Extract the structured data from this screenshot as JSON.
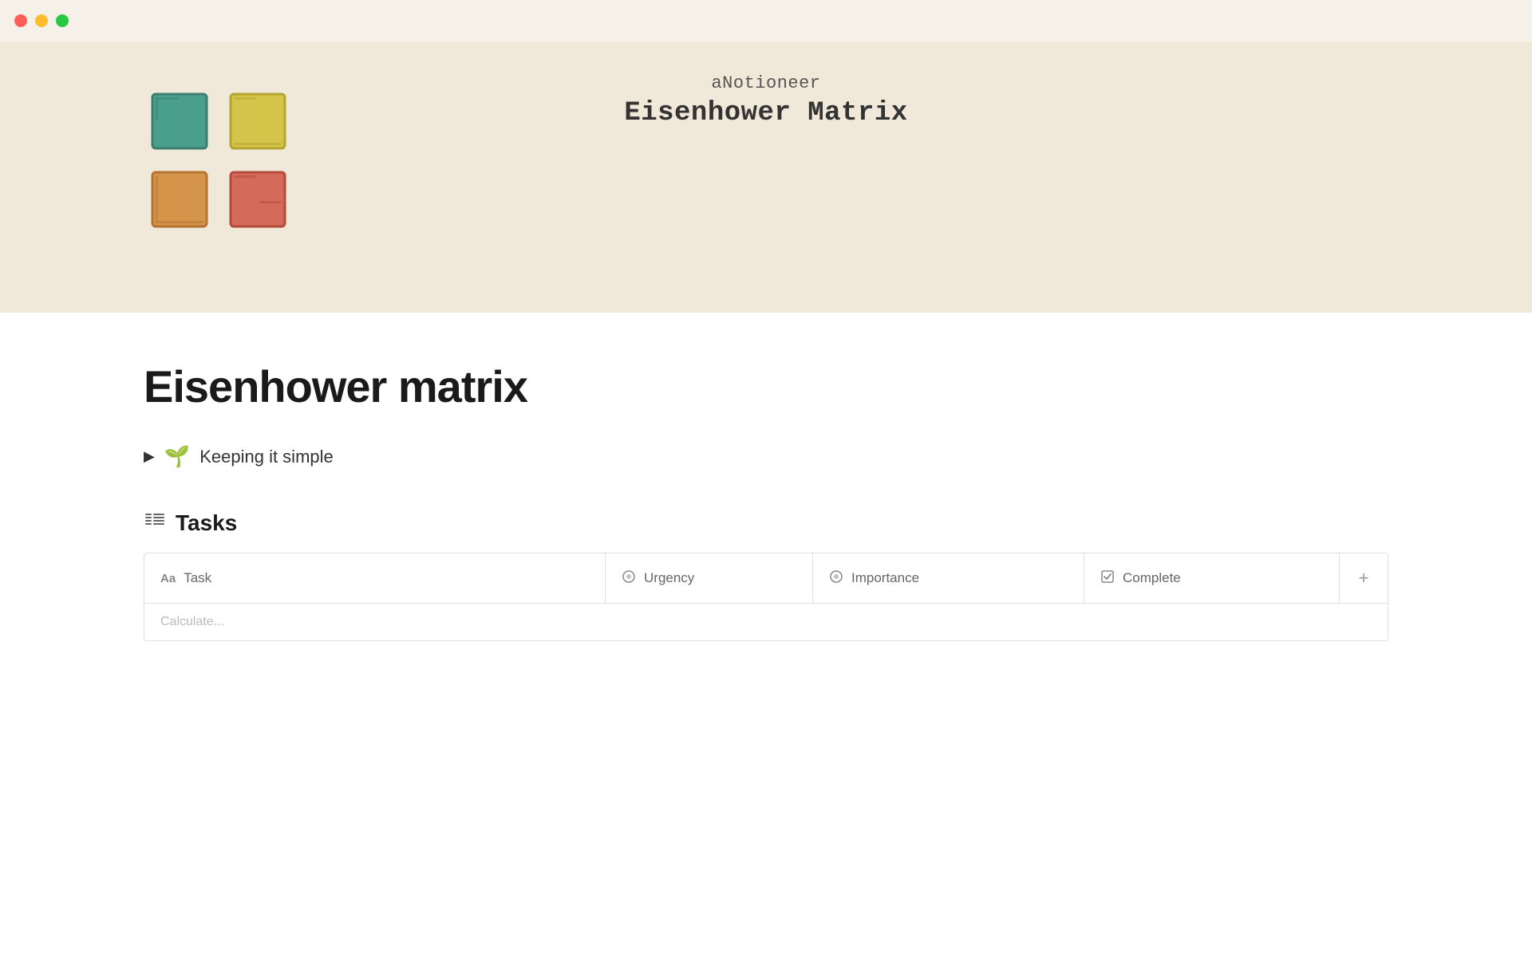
{
  "titlebar": {
    "traffic_lights": [
      "close",
      "minimize",
      "maximize"
    ]
  },
  "banner": {
    "subtitle": "aNotioneer",
    "title": "Eisenhower Matrix",
    "matrix_colors": {
      "top_left": "#4a9e8e",
      "top_right": "#d4c44a",
      "bottom_left": "#d4944a",
      "bottom_right": "#d46a5a"
    }
  },
  "page": {
    "title": "Eisenhower matrix"
  },
  "toggle": {
    "arrow": "▶",
    "emoji": "🌱",
    "text": "Keeping it simple"
  },
  "tasks_section": {
    "icon": "≋",
    "title": "Tasks"
  },
  "table": {
    "columns": [
      {
        "id": "task",
        "icon": "Aa",
        "label": "Task"
      },
      {
        "id": "urgency",
        "icon": "⊙",
        "label": "Urgency"
      },
      {
        "id": "importance",
        "icon": "⊙",
        "label": "Importance"
      },
      {
        "id": "complete",
        "icon": "☑",
        "label": "Complete"
      }
    ],
    "add_button": "+"
  },
  "bottom_row": {
    "hint": "Calculate..."
  }
}
